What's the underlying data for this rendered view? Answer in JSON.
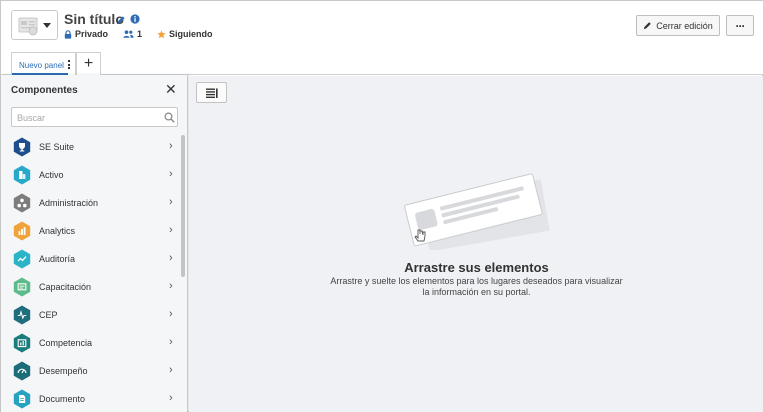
{
  "header": {
    "title": "Sin título",
    "privacy_label": "Privado",
    "users_count": "1",
    "following_label": "Siguiendo",
    "close_edit_label": "Cerrar edición",
    "more_label": "···"
  },
  "tabs": [
    {
      "label": "Nuevo panel",
      "active": true
    }
  ],
  "tab_add_label": "+",
  "components_panel": {
    "title": "Componentes",
    "close_label": "✕",
    "search_placeholder": "Buscar",
    "items": [
      {
        "label": "SE Suite",
        "icon": "trophy-icon",
        "color": "#1f4e8c"
      },
      {
        "label": "Activo",
        "icon": "building-icon",
        "color": "#29a9c9"
      },
      {
        "label": "Administración",
        "icon": "org-chart-icon",
        "color": "#7d7d7d"
      },
      {
        "label": "Analytics",
        "icon": "bar-chart-icon",
        "color": "#f0a33a"
      },
      {
        "label": "Auditoría",
        "icon": "audit-icon",
        "color": "#2bb3c7"
      },
      {
        "label": "Capacitación",
        "icon": "training-icon",
        "color": "#5cbb8a"
      },
      {
        "label": "CEP",
        "icon": "pulse-icon",
        "color": "#1f6e7d"
      },
      {
        "label": "Competencia",
        "icon": "competence-icon",
        "color": "#1c7c7c"
      },
      {
        "label": "Desempeño",
        "icon": "gauge-icon",
        "color": "#1c6d78"
      },
      {
        "label": "Documento",
        "icon": "document-icon",
        "color": "#26a3c0"
      }
    ]
  },
  "canvas": {
    "empty_title": "Arrastre sus elementos",
    "empty_description": "Arrastre y suelte los elementos para los lugares deseados para visualizar la información en su portal."
  },
  "colors": {
    "accent": "#2e6db5",
    "info": "#2e6db5",
    "star": "#f0a33a",
    "canvas_bg": "#eff1f4"
  }
}
